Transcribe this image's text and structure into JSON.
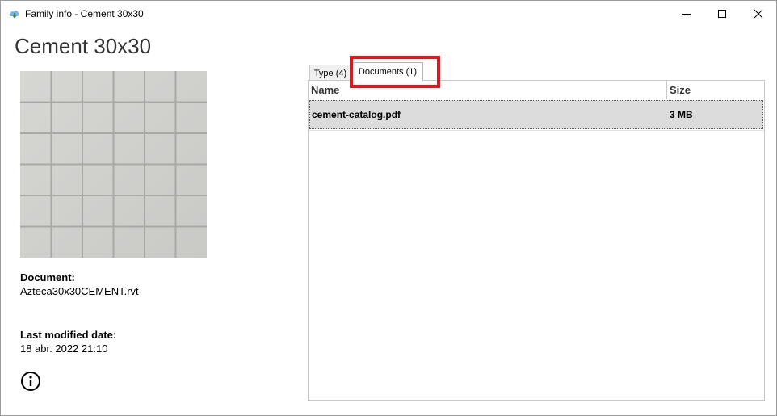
{
  "window": {
    "title": "Family info - Cement 30x30",
    "icon": "cloud-download-icon"
  },
  "family": {
    "title": "Cement 30x30",
    "preview_colors": {
      "tile": "#d2d2cf",
      "grout": "#a8a8a5"
    }
  },
  "details": {
    "document_label": "Document:",
    "document_value": "Azteca30x30CEMENT.rvt",
    "modified_label": "Last modified date:",
    "modified_value": "18 abr. 2022 21:10",
    "info_icon": "info-circle-icon"
  },
  "tabs": [
    {
      "label": "Type (4)",
      "active": false
    },
    {
      "label": "Documents (1)",
      "active": true
    }
  ],
  "highlight_color": "#e0161e",
  "grid": {
    "columns": [
      "Name",
      "Size"
    ],
    "rows": [
      {
        "name": "cement-catalog.pdf",
        "size": "3 MB",
        "selected": true
      }
    ]
  }
}
